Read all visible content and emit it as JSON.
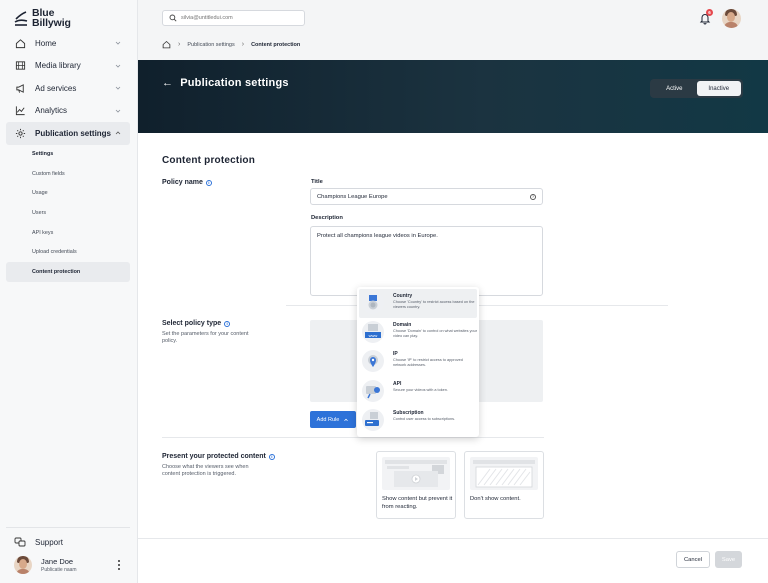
{
  "brand": {
    "name_line1": "Blue",
    "name_line2": "Billywig"
  },
  "nav": {
    "items": [
      {
        "label": "Home",
        "icon": "home-icon"
      },
      {
        "label": "Media library",
        "icon": "film-icon"
      },
      {
        "label": "Ad services",
        "icon": "megaphone-icon"
      },
      {
        "label": "Analytics",
        "icon": "chart-line-icon"
      },
      {
        "label": "Publication settings",
        "icon": "gear-icon"
      }
    ],
    "sub_items": [
      "Settings",
      "Custom fields",
      "Usage",
      "Users",
      "API keys",
      "Upload credentials",
      "Content protection"
    ],
    "support_label": "Support"
  },
  "user": {
    "name": "Jane Doe",
    "team": "Publicatie naam"
  },
  "search": {
    "placeholder": "silvia@untitledui.com"
  },
  "notifications": {
    "count": "6"
  },
  "breadcrumb": {
    "items": [
      "Publication settings",
      "Content protection"
    ]
  },
  "hero": {
    "title": "Publication settings",
    "toggle_active": "Active",
    "toggle_inactive": "Inactive"
  },
  "content": {
    "section_title": "Content protection",
    "policy_name_label": "Policy name",
    "title_label": "Title",
    "title_value": "Champions League Europe",
    "description_label": "Description",
    "description_value": "Protect all champions league videos in Europe.",
    "policy_type_label": "Select policy type",
    "policy_type_desc": "Set the parameters for your content policy.",
    "add_rule_label": "Add Rule",
    "present_label": "Present your protected content",
    "present_desc": "Choose what the viewers see when content protection is triggered.",
    "card1_caption": "Show content but prevent it from reacting.",
    "card2_caption": "Don't show content."
  },
  "dropdown": {
    "items": [
      {
        "title": "Country",
        "desc": "Choose 'Country' to restrict access based on the viewers country."
      },
      {
        "title": "Domain",
        "desc": "Choose 'Domain' to control on what websites your video can play."
      },
      {
        "title": "IP",
        "desc": "Choose 'IP' to restrict access to approved network addresses."
      },
      {
        "title": "API",
        "desc": "Secure your videos with a token."
      },
      {
        "title": "Subscription",
        "desc": "Control user access to subscriptions."
      }
    ],
    "domain_icon_text": "www"
  },
  "footer": {
    "cancel_label": "Cancel",
    "save_label": "Save"
  },
  "colors": {
    "accent": "#2d72d9",
    "hero_dark": "#10202c",
    "badge": "#e5484d"
  }
}
